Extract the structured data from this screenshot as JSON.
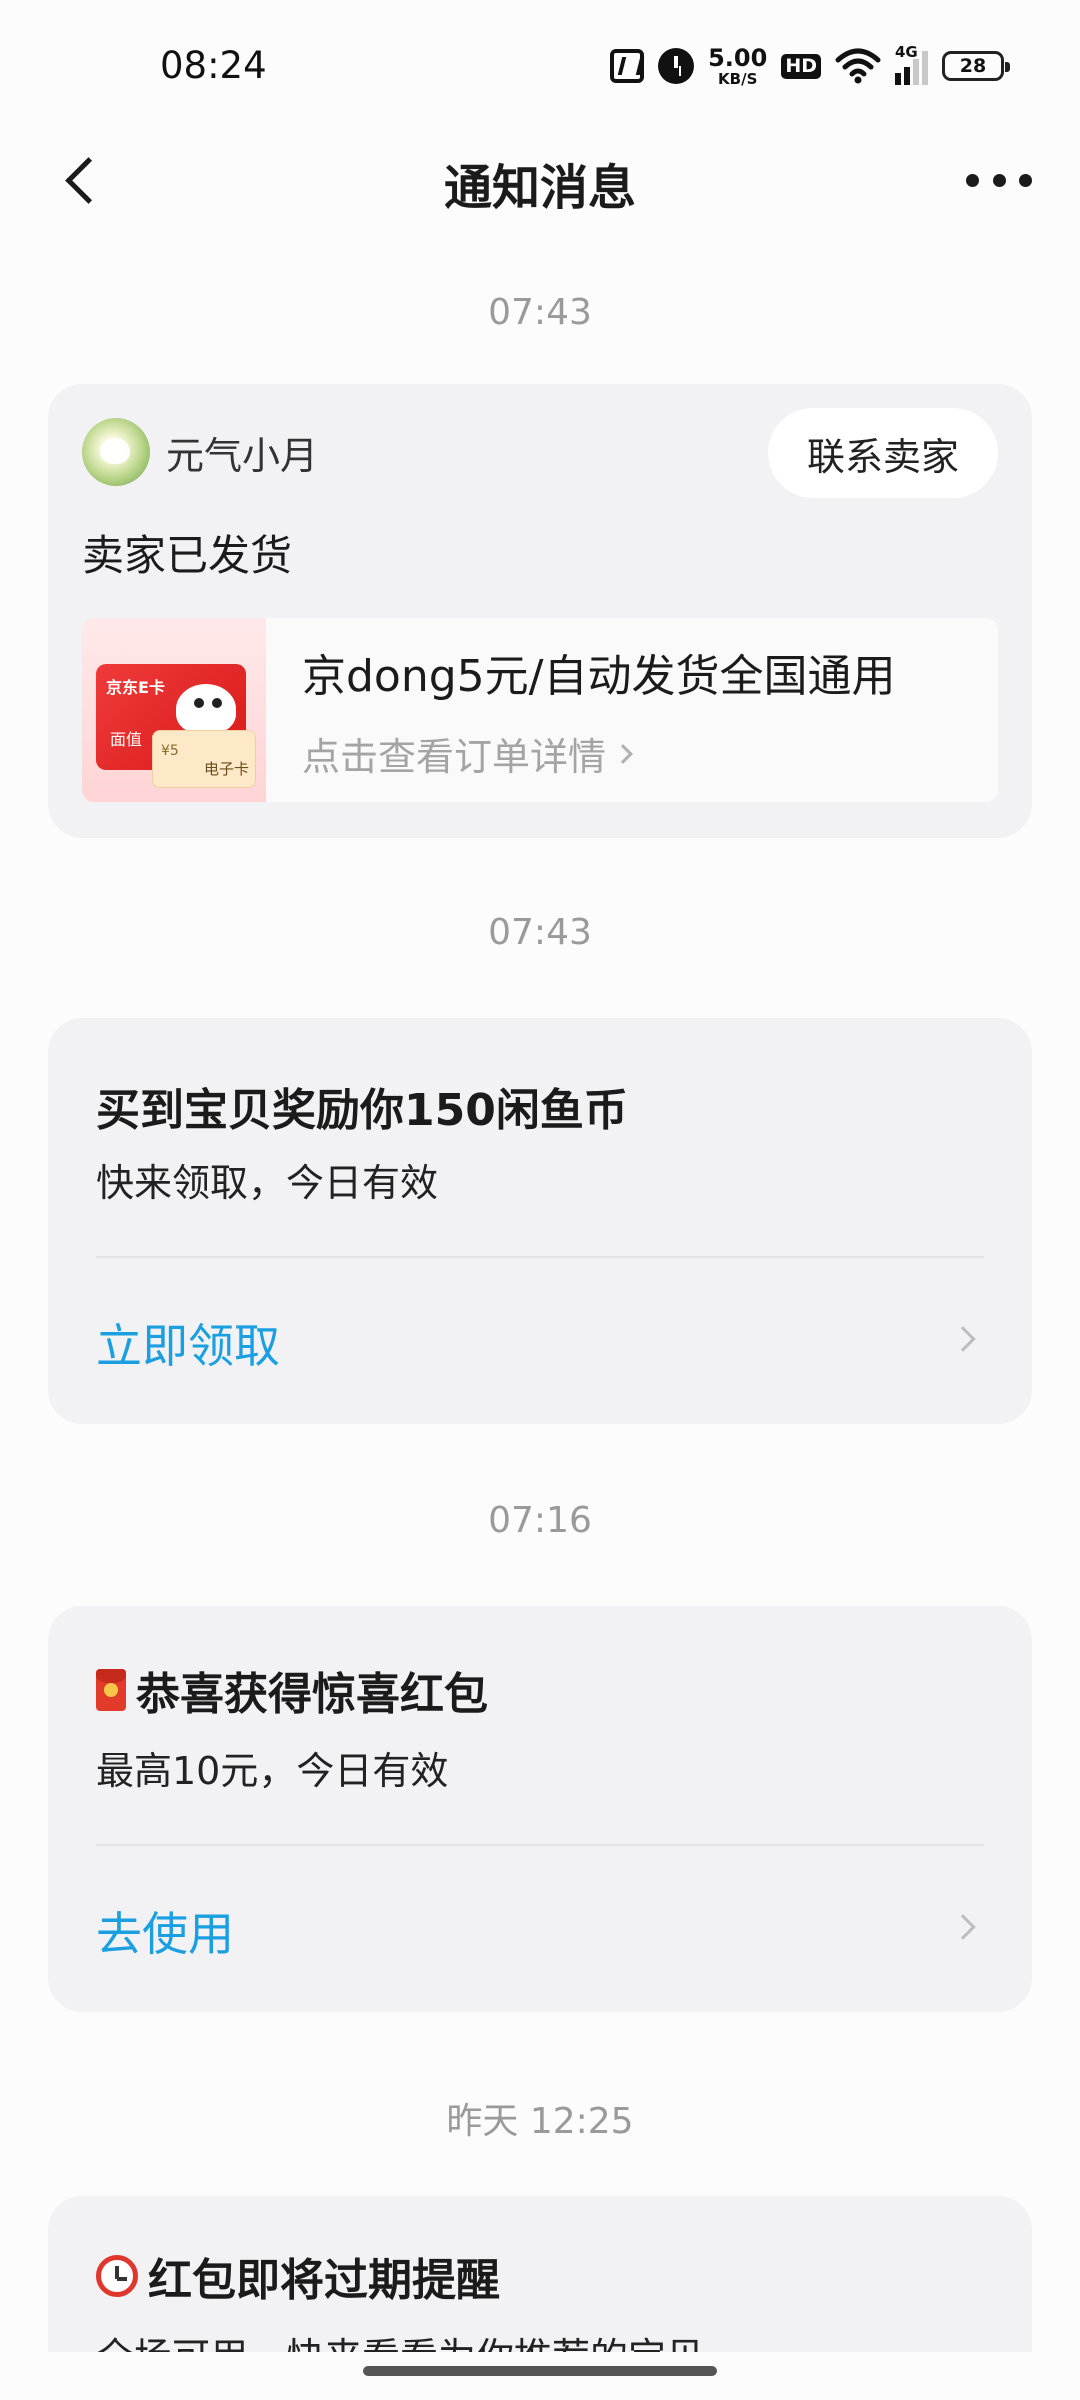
{
  "status_bar": {
    "time": "08:24",
    "net_speed_value": "5.00",
    "net_speed_unit": "KB/S",
    "hd_label": "HD",
    "network_label": "4G",
    "battery": "28",
    "icons": [
      "nfc-icon",
      "alarm-icon",
      "wifi-icon",
      "signal-icon",
      "battery-icon"
    ]
  },
  "header": {
    "title": "通知消息",
    "icons": [
      "back-icon",
      "more-icon"
    ]
  },
  "notifications": [
    {
      "time": "07:43",
      "seller_name": "元气小月",
      "contact_label": "联系卖家",
      "status": "卖家已发货",
      "product": {
        "thumb_brand": "京东E卡",
        "thumb_face_label": "面值",
        "thumb_card_label": "电子卡",
        "thumb_card_value": "¥5",
        "title": "京dong5元/自动发货全国通用",
        "link_label": "点击查看订单详情"
      }
    },
    {
      "time": "07:43",
      "title": "买到宝贝奖励你150闲鱼币",
      "subtitle": "快来领取，今日有效",
      "action": "立即领取"
    },
    {
      "time": "07:16",
      "title": "恭喜获得惊喜红包",
      "subtitle": "最高10元，今日有效",
      "action": "去使用",
      "icon": "red-packet-icon"
    },
    {
      "time": "昨天 12:25",
      "title": "红包即将过期提醒",
      "subtitle": "全场可用，快来看看为你推荐的宝贝",
      "icon": "alarm-clock-icon"
    }
  ],
  "colors": {
    "accent": "#1a9fe0",
    "card_bg": "#f2f2f4",
    "page_bg": "#fcfcfd",
    "timestamp": "#9a9a9a"
  }
}
